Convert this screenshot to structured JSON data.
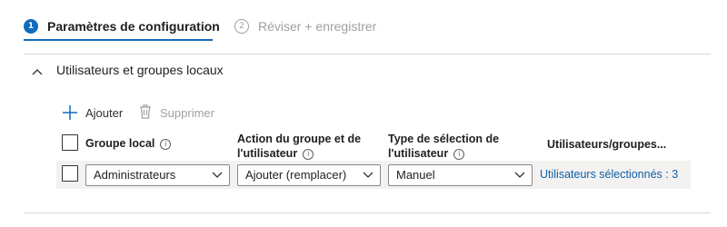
{
  "tabs": [
    {
      "number": "1",
      "label": "Paramètres de configuration",
      "active": true
    },
    {
      "number": "2",
      "label": "Réviser + enregistrer",
      "active": false
    }
  ],
  "section": {
    "title": "Utilisateurs et groupes locaux",
    "expanded": true
  },
  "toolbar": {
    "add_label": "Ajouter",
    "delete_label": "Supprimer"
  },
  "table": {
    "columns": [
      {
        "line1": "Groupe local",
        "line2": ""
      },
      {
        "line1": "Action du groupe et de",
        "line2": "l'utilisateur"
      },
      {
        "line1": "Type de sélection de",
        "line2": "l'utilisateur"
      },
      {
        "line1": "Utilisateurs/groupes...",
        "line2": ""
      }
    ],
    "rows": [
      {
        "group": "Administrateurs",
        "action": "Ajouter (remplacer)",
        "selection_type": "Manuel",
        "users_link": "Utilisateurs sélectionnés : 3"
      }
    ]
  },
  "colors": {
    "accent": "#0f6cbd",
    "link": "#0f5fa6",
    "row_background": "#f3f2f1",
    "disabled_text": "#a19f9d"
  },
  "icons": [
    "info-icon",
    "plus-icon",
    "trash-icon",
    "chevron-up-icon",
    "chevron-down-icon"
  ]
}
